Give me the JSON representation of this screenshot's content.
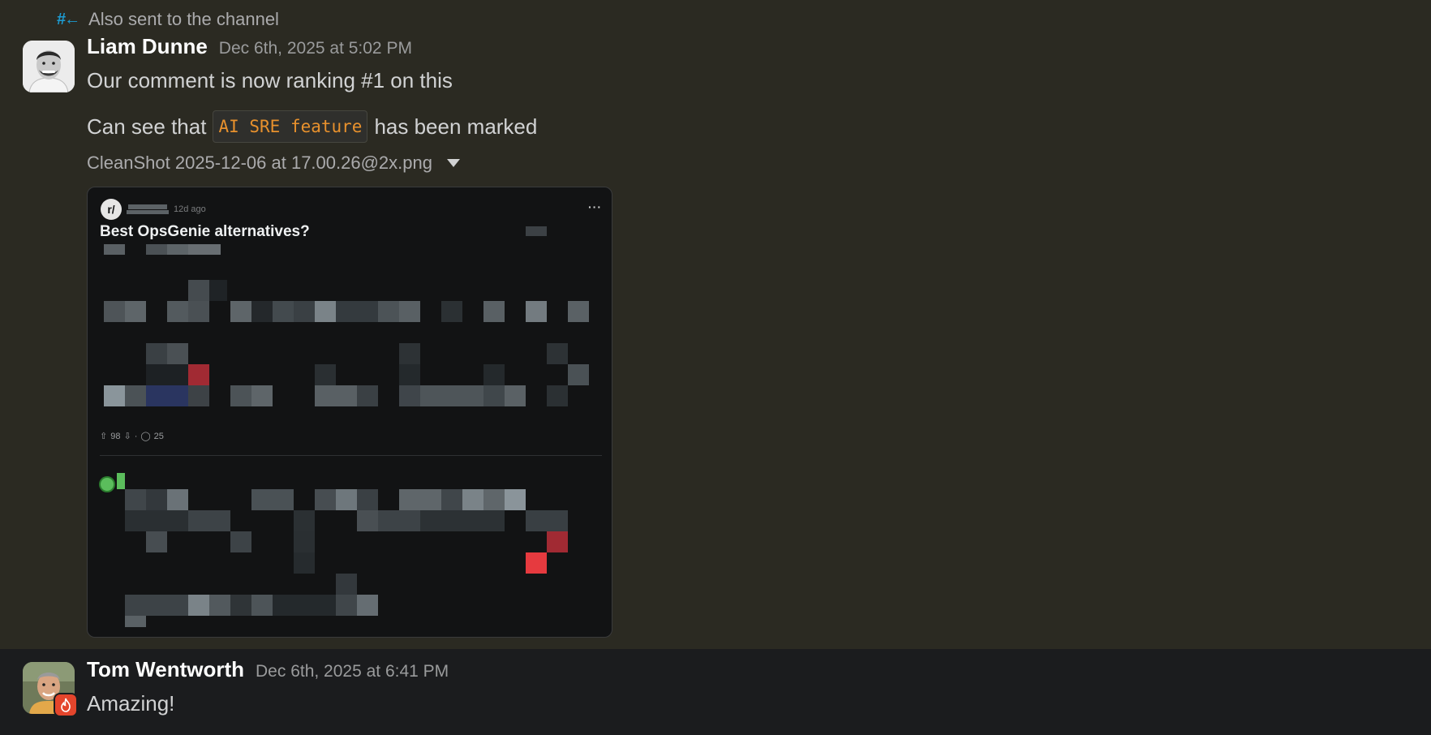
{
  "channel_notice": {
    "icon": "hash-share-icon",
    "text": "Also sent to the channel"
  },
  "messages": [
    {
      "author": "Liam Dunne",
      "timestamp": "Dec 6th, 2025 at 5:02 PM",
      "line1": "Our comment is now ranking #1 on this",
      "line2_before": "Can see that",
      "line2_code": "AI SRE feature",
      "line2_after": "has been marked",
      "attachment": {
        "filename": "CleanShot 2025-12-06 at 17.00.26@2x.png",
        "preview": {
          "subreddit_logo": "r/",
          "age": "12d ago",
          "title": "Best OpsGenie alternatives?",
          "upvotes": "98",
          "comments": "25",
          "more": "···"
        }
      }
    },
    {
      "author": "Tom Wentworth",
      "timestamp": "Dec 6th, 2025 at 6:41 PM",
      "text": "Amazing!",
      "status_badge_icon": "fire-icon"
    }
  ],
  "colors": {
    "background": "#2b2a22",
    "highlight_background": "#1b1c1e",
    "code": "#e8912d",
    "link_icon": "#1d9bd1",
    "badge": "#e4452c"
  }
}
